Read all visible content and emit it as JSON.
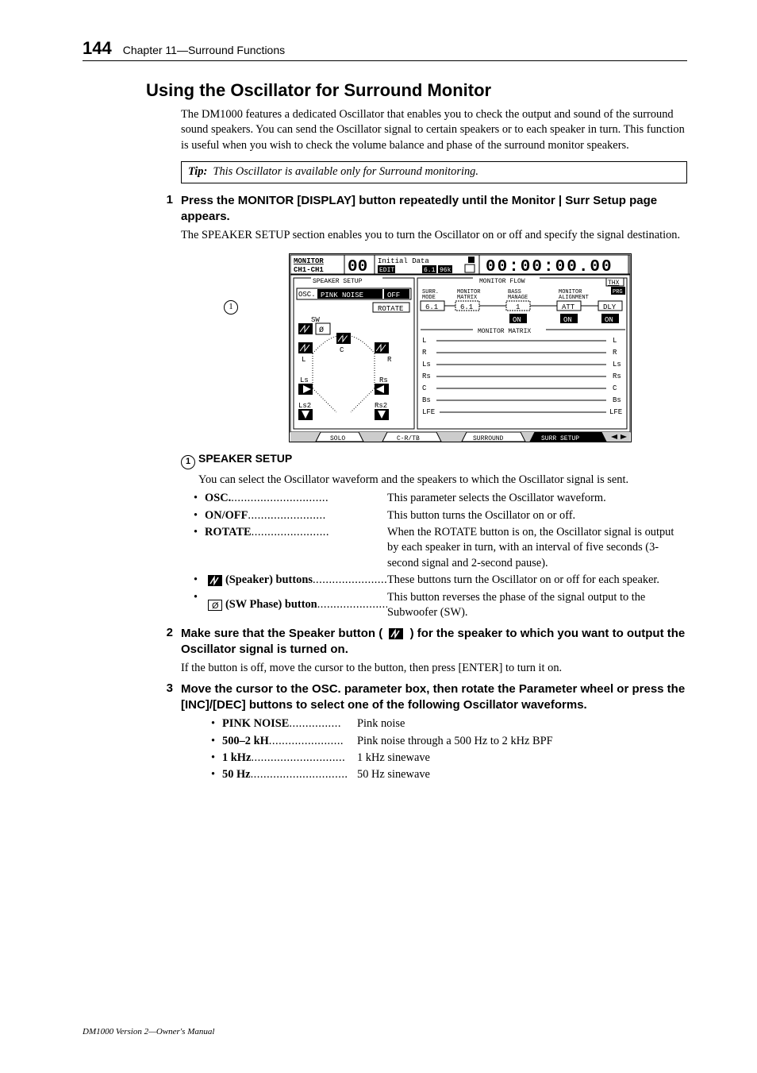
{
  "header": {
    "page_number": "144",
    "chapter": "Chapter 11—Surround Functions"
  },
  "heading": "Using the Oscillator for Surround Monitor",
  "intro": "The DM1000 features a dedicated Oscillator that enables you to check the output and sound of the surround sound speakers. You can send the Oscillator signal to certain speakers or to each speaker in turn. This function is useful when you wish to check the volume balance and phase of the surround monitor speakers.",
  "tip": {
    "label": "Tip:",
    "text": "This Oscillator is available only for Surround monitoring."
  },
  "steps": [
    {
      "num": "1",
      "title": "Press the MONITOR [DISPLAY] button repeatedly until the Monitor | Surr Setup page appears.",
      "follow": "The SPEAKER SETUP section enables you to turn the Oscillator on or off and specify the signal destination."
    },
    {
      "num": "2",
      "pre": "Make sure that the Speaker button (",
      "post": ") for the speaker to which you want to output the Oscillator signal is turned on.",
      "follow": "If the button is off, move the cursor to the button, then press [ENTER] to turn it on."
    },
    {
      "num": "3",
      "title": "Move the cursor to the OSC. parameter box, then rotate the Parameter wheel or press the [INC]/[DEC] buttons to select one of the following Oscillator waveforms."
    }
  ],
  "screenshot": {
    "title_bar": {
      "area": "MONITOR",
      "ch": "CH1-CH1",
      "scene": {
        "num": "00",
        "name": "Initial Data",
        "tag1": "EDIT",
        "tag2": "6.1",
        "tag3": "96k"
      },
      "tc": "00:00:00.00"
    },
    "speaker_setup": {
      "label": "SPEAKER SETUP",
      "osc_label": "OSC.",
      "osc_value": "PINK NOISE",
      "osc_on": "OFF",
      "rotate_label": "ROTATE",
      "sw_label": "SW",
      "channels": [
        "L",
        "C",
        "R",
        "Ls",
        "Rs",
        "Ls2",
        "Rs2"
      ]
    },
    "monitor_flow": {
      "label": "MONITOR FLOW",
      "thx": "THX",
      "cols": [
        "SURR.\nMODE",
        "MONITOR\nMATRIX",
        "BASS\nMANAGE",
        "MONITOR\nALIGNMENT"
      ],
      "vals": [
        "6.1",
        "6.1",
        "1",
        "ATT",
        "DLY"
      ],
      "ons": [
        "ON",
        "ON",
        "ON"
      ]
    },
    "monitor_matrix": {
      "label": "MONITOR MATRIX",
      "left": [
        "L",
        "R",
        "Ls",
        "Rs",
        "C",
        "Bs",
        "LFE"
      ],
      "right": [
        "L",
        "R",
        "Ls",
        "Rs",
        "C",
        "Bs",
        "LFE"
      ]
    },
    "tabs": [
      "SOLO",
      "C-R/TB",
      "SURROUND",
      "SURR SETUP"
    ]
  },
  "section1": {
    "label": "SPEAKER SETUP",
    "intro": "You can select the Oscillator waveform and the speakers to which the Oscillator signal is sent.",
    "params": [
      {
        "name": "OSC.",
        "dots": "..............................",
        "desc": "This parameter selects the Oscillator waveform."
      },
      {
        "name": "ON/OFF",
        "dots": "........................",
        "desc": "This button turns the Oscillator on or off."
      },
      {
        "name": "ROTATE",
        "dots": "........................",
        "desc": "When the ROTATE button is on, the Oscillator signal is output by each speaker in turn, with an interval of five seconds (3-second signal and 2-second pause)."
      },
      {
        "icon": "speaker",
        "name": " (Speaker) buttons",
        "dots": ".......................",
        "desc": "These buttons turn the Oscillator on or off for each speaker."
      },
      {
        "icon": "swphase",
        "name": " (SW Phase) button",
        "dots": "......................",
        "desc": "This button reverses the phase of the signal output to the Subwoofer (SW)."
      }
    ]
  },
  "waveforms": [
    {
      "name": "PINK NOISE",
      "dots": "................",
      "desc": "Pink noise"
    },
    {
      "name": "500–2 kH",
      "dots": ".......................",
      "desc": "Pink noise through a 500 Hz to 2 kHz BPF"
    },
    {
      "name": "1 kHz",
      "dots": ".............................",
      "desc": "1 kHz sinewave"
    },
    {
      "name": "50 Hz",
      "dots": "..............................",
      "desc": "50 Hz sinewave"
    }
  ],
  "footer": "DM1000 Version 2—Owner's Manual"
}
